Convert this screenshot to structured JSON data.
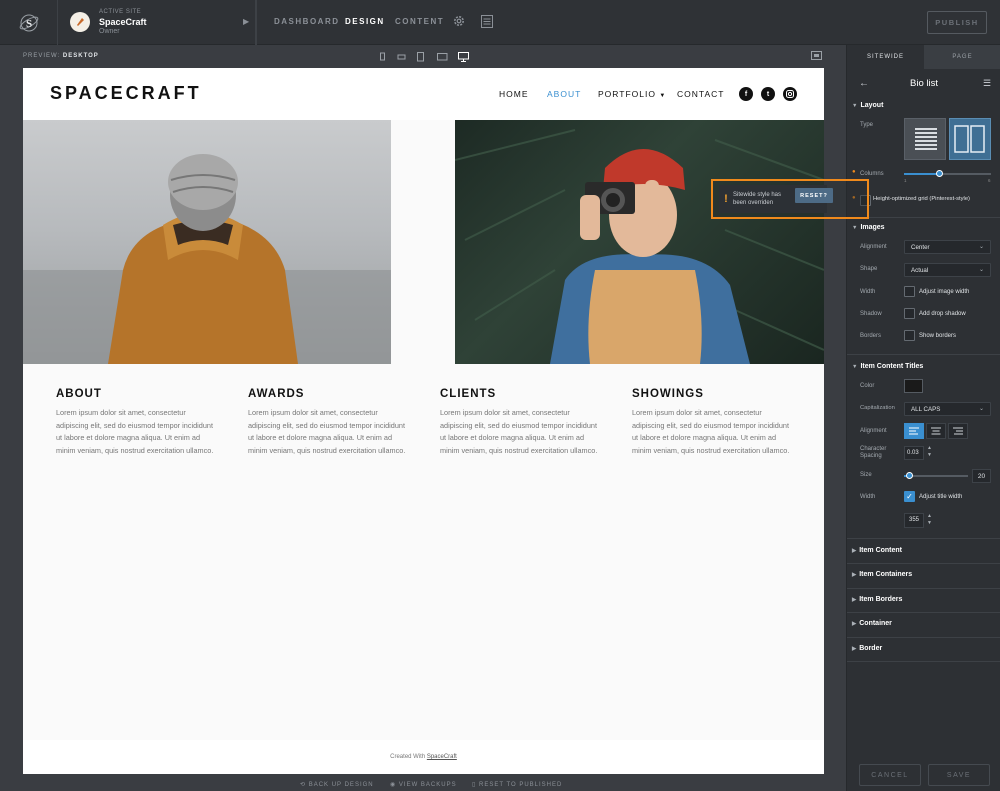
{
  "topbar": {
    "active_site_small": "ACTIVE SITE",
    "site_name": "SpaceCraft",
    "site_role": "Owner",
    "nav": [
      "DASHBOARD",
      "DESIGN",
      "CONTENT"
    ],
    "active_nav": "DESIGN",
    "publish_label": "PUBLISH"
  },
  "preview": {
    "label": "PREVIEW:",
    "mode": "DESKTOP",
    "devices": [
      "phone-portrait-icon",
      "phone-landscape-icon",
      "tablet-portrait-icon",
      "tablet-landscape-icon",
      "desktop-icon"
    ]
  },
  "site": {
    "brand": "SPACECRAFT",
    "menu": [
      "HOME",
      "ABOUT",
      "PORTFOLIO",
      "CONTACT"
    ],
    "active_menu": "ABOUT",
    "social": [
      "facebook-icon",
      "twitter-icon",
      "instagram-icon"
    ],
    "columns": [
      {
        "title": "ABOUT",
        "text": "Lorem ipsum dolor sit amet, consectetur adipiscing elit, sed do eiusmod tempor incididunt ut labore et dolore magna aliqua. Ut enim ad minim veniam, quis nostrud exercitation ullamco."
      },
      {
        "title": "AWARDS",
        "text": "Lorem ipsum dolor sit amet, consectetur adipiscing elit, sed do eiusmod tempor incididunt ut labore et dolore magna aliqua. Ut enim ad minim veniam, quis nostrud exercitation ullamco."
      },
      {
        "title": "CLIENTS",
        "text": "Lorem ipsum dolor sit amet, consectetur adipiscing elit, sed do eiusmod tempor incididunt ut labore et dolore magna aliqua. Ut enim ad minim veniam, quis nostrud exercitation ullamco."
      },
      {
        "title": "SHOWINGS",
        "text": "Lorem ipsum dolor sit amet, consectetur adipiscing elit, sed do eiusmod tempor incididunt ut labore et dolore magna aliqua. Ut enim ad minim veniam, quis nostrud exercitation ullamco."
      }
    ],
    "footer_text": "Created With",
    "footer_link": "SpaceCraft"
  },
  "bottom_actions": [
    "BACK UP DESIGN",
    "VIEW BACKUPS",
    "RESET TO PUBLISHED"
  ],
  "popup": {
    "message": "Sitewide style has been overriden",
    "reset_label": "RESET?"
  },
  "panel": {
    "tabs": [
      "SITEWIDE",
      "PAGE"
    ],
    "active_tab": "SITEWIDE",
    "title": "Bio list",
    "layout": {
      "heading": "Layout",
      "type_label": "Type",
      "columns_label": "Columns",
      "columns_ticks_min": "1",
      "columns_ticks_max": "6",
      "columns_value": 3,
      "pinterest_label": "Height-optimized grid (Pinterest-style)"
    },
    "images": {
      "heading": "Images",
      "alignment_label": "Alignment",
      "alignment_value": "Center",
      "shape_label": "Shape",
      "shape_value": "Actual",
      "width_label": "Width",
      "width_check": "Adjust image width",
      "shadow_label": "Shadow",
      "shadow_check": "Add drop shadow",
      "borders_label": "Borders",
      "borders_check": "Show borders"
    },
    "titles": {
      "heading": "Item Content Titles",
      "color_label": "Color",
      "color_value": "#1a1a1a",
      "cap_label": "Capitalization",
      "cap_value": "ALL CAPS",
      "align_label": "Alignment",
      "char_label": "Character Spacing",
      "char_value": "0.03",
      "size_label": "Size",
      "size_value": "20",
      "width_label": "Width",
      "width_check": "Adjust title width",
      "width_value": "355"
    },
    "collapsed": [
      "Item Content",
      "Item Containers",
      "Item Borders",
      "Container",
      "Border"
    ],
    "cancel_label": "CANCEL",
    "save_label": "SAVE"
  },
  "colors": {
    "accent": "#3a8fd0",
    "warning": "#f08a1c"
  }
}
